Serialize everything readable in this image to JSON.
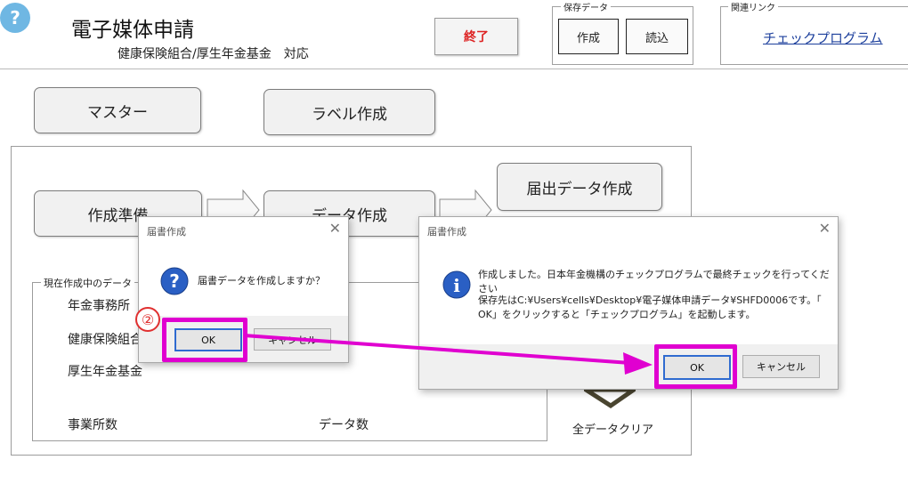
{
  "header": {
    "help_glyph": "?",
    "title": "電子媒体申請",
    "subtitle": "健康保険組合/厚生年金基金　対応",
    "exit_label": "終了"
  },
  "save_group": {
    "label": "保存データ",
    "create_label": "作成",
    "load_label": "読込"
  },
  "link_group": {
    "label": "関連リンク",
    "link_label": "チェックプログラム"
  },
  "top_buttons": {
    "master": "マスター",
    "label_create": "ラベル作成"
  },
  "workflow": {
    "step1": "作成準備",
    "step2": "データ作成",
    "step3": "届出データ作成"
  },
  "current_data": {
    "label": "現在作成中のデータ",
    "pension_office": "年金事務所",
    "health_insurance": "健康保険組合",
    "pension_fund": "厚生年金基金",
    "office_count": "事業所数",
    "data_count": "データ数"
  },
  "clear_all_label": "全データクリア",
  "dialog_confirm": {
    "title": "届書作成",
    "message": "届書データを作成しますか？",
    "ok_label": "OK",
    "cancel_label": "キャンセル"
  },
  "dialog_done": {
    "title": "届書作成",
    "line1": "作成しました。日本年金機構のチェックプログラムで最終チェックを行ってください",
    "line2": "保存先はC:¥Users¥cells¥Desktop¥電子媒体申請データ¥SHFD0006です。「",
    "line3": "OK」をクリックすると「チェックプログラム」を起動します。",
    "ok_label": "OK",
    "cancel_label": "キャンセル"
  },
  "annotation": {
    "step_marker": "②",
    "highlight_color": "#e000d0"
  }
}
